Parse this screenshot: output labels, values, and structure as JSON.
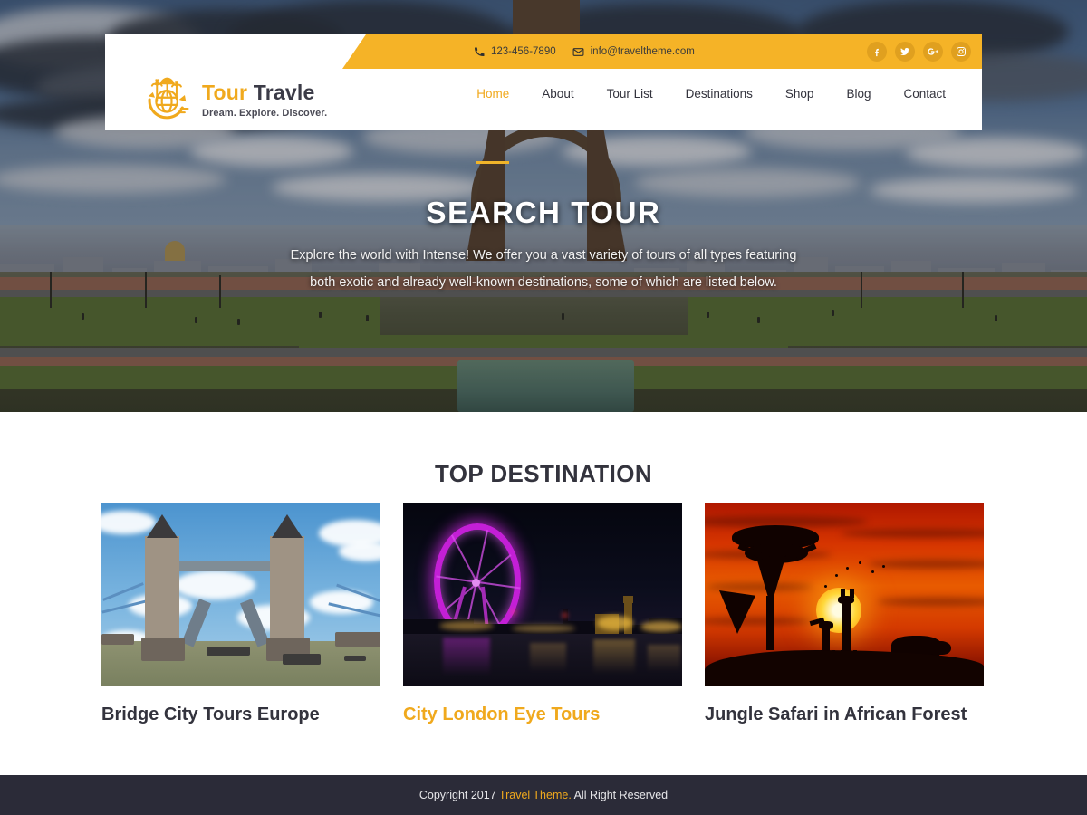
{
  "site": {
    "logo": {
      "icon": "globe-palm-umbrella-icon",
      "name_part1": "Tour",
      "name_part2": "Travle",
      "tagline": "Dream. Explore. Discover."
    },
    "topbar": {
      "phone_icon": "phone-icon",
      "phone": "123-456-7890",
      "email_icon": "envelope-icon",
      "email": "info@traveltheme.com",
      "socials": [
        {
          "name": "facebook-icon",
          "glyph": "f"
        },
        {
          "name": "twitter-icon",
          "glyph": "t"
        },
        {
          "name": "google-plus-icon",
          "glyph": "G+"
        },
        {
          "name": "instagram-icon",
          "glyph": "ig"
        }
      ]
    },
    "nav": [
      {
        "label": "Home",
        "active": true
      },
      {
        "label": "About",
        "active": false
      },
      {
        "label": "Tour List",
        "active": false
      },
      {
        "label": "Destinations",
        "active": false
      },
      {
        "label": "Shop",
        "active": false
      },
      {
        "label": "Blog",
        "active": false
      },
      {
        "label": "Contact",
        "active": false
      }
    ]
  },
  "hero": {
    "title": "SEARCH TOUR",
    "subtitle_line1": "Explore the world with Intense! We offer you a vast variety of tours of all types featuring",
    "subtitle_line2": "both exotic and already well-known destinations, some of which are listed below.",
    "background": "eiffel-tower-paris-photo"
  },
  "destinations": {
    "heading": "TOP DESTINATION",
    "cards": [
      {
        "title": "Bridge City Tours Europe",
        "image": "tower-bridge-london-photo",
        "highlighted": false
      },
      {
        "title": "City London Eye Tours",
        "image": "london-eye-night-photo",
        "highlighted": true
      },
      {
        "title": "Jungle Safari in African Forest",
        "image": "african-sunset-safari-photo",
        "highlighted": false
      }
    ]
  },
  "footer": {
    "copyright_prefix": "Copyright 2017 ",
    "brand": "Travel Theme.",
    "copyright_suffix": " All Right Reserved"
  },
  "colors": {
    "accent": "#f0a91d",
    "topbar_yellow": "#f5b327",
    "dark_text": "#33333d",
    "footer_bg": "#2b2b38"
  }
}
